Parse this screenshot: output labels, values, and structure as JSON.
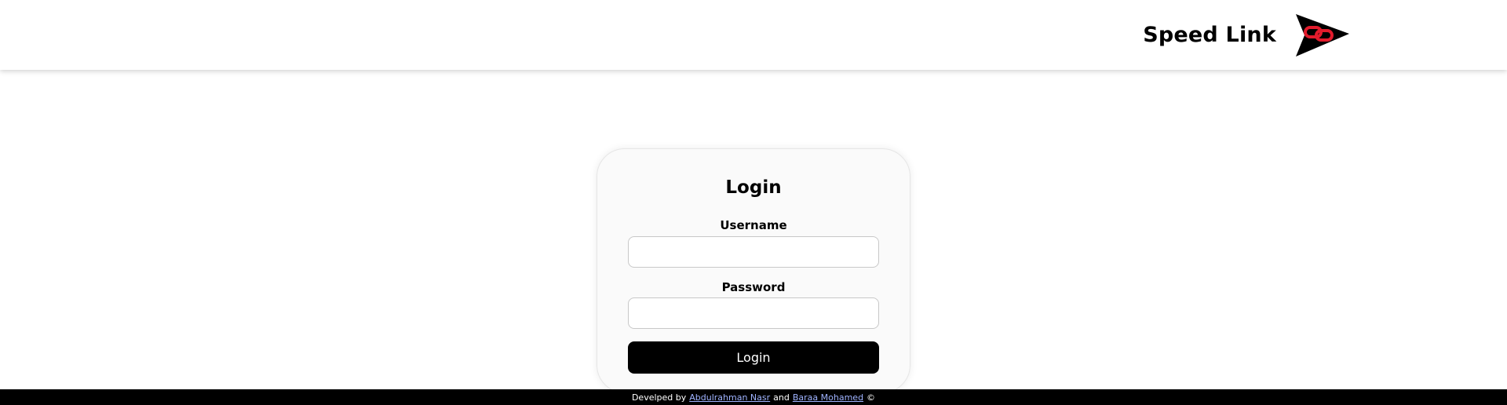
{
  "header": {
    "brand_name": "Speed Link",
    "logo_icon": "arrow-chain-link-icon"
  },
  "login_card": {
    "title": "Login",
    "username_label": "Username",
    "username_value": "",
    "password_label": "Password",
    "password_value": "",
    "submit_label": "Login"
  },
  "footer": {
    "prefix": "Develped by",
    "author1": "Abdulrahman Nasr",
    "connector": "and",
    "author2": "Baraa Mohamed",
    "copyright": "©"
  },
  "colors": {
    "accent": "#e21b2c",
    "button_bg": "#000000",
    "footer_bg": "#000000",
    "link": "#9fb3ff"
  }
}
